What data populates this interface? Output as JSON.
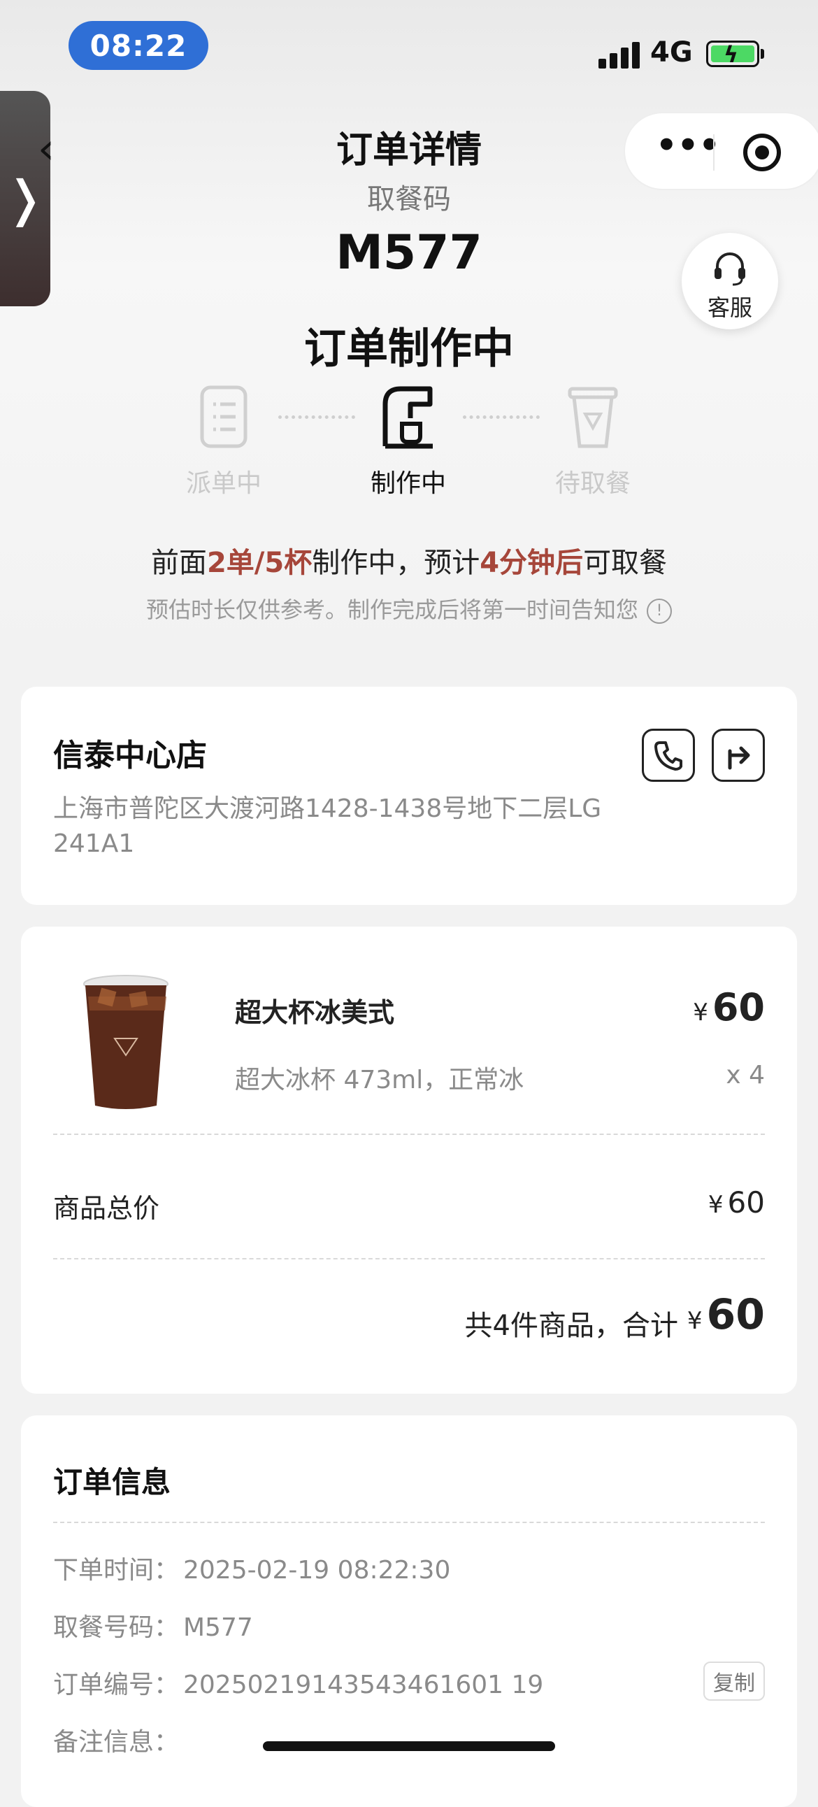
{
  "status_bar": {
    "time": "08:22",
    "network": "4G"
  },
  "nav": {
    "back_glyph": "‹",
    "title": "订单详情",
    "more_glyph": "•••",
    "side_tab_glyph": "❭"
  },
  "order_status": {
    "pickup_label": "取餐码",
    "pickup_code": "M577",
    "status_title": "订单制作中",
    "service_label": "客服",
    "steps": [
      {
        "label": "派单中",
        "state": "done"
      },
      {
        "label": "制作中",
        "state": "active"
      },
      {
        "label": "待取餐",
        "state": "pending"
      }
    ],
    "wait": {
      "prefix": "前面",
      "queue": "2单/5杯",
      "mid": "制作中，预计",
      "eta": "4分钟后",
      "suffix": "可取餐"
    },
    "note": "预估时长仅供参考。制作完成后将第一时间告知您",
    "note_icon": "!"
  },
  "store": {
    "name": "信泰中心店",
    "address": "上海市普陀区大渡河路1428-1438号地下二层LG 241A1"
  },
  "items": {
    "list": [
      {
        "name": "超大杯冰美式",
        "spec": "超大冰杯 473ml，正常冰",
        "currency": "¥",
        "price": "60",
        "qty": "x 4"
      }
    ],
    "subtotal_label": "商品总价",
    "subtotal_currency": "¥",
    "subtotal": "60",
    "total_text": "共4件商品，合计",
    "total_currency": "¥",
    "total": "60"
  },
  "order_info": {
    "title": "订单信息",
    "rows": [
      {
        "label": "下单时间：",
        "value": "2025-02-19 08:22:30"
      },
      {
        "label": "取餐号码：",
        "value": "M577"
      },
      {
        "label": "订单编号：",
        "value": "20250219143543461601 19"
      },
      {
        "label": "备注信息：",
        "value": ""
      }
    ],
    "copy_label": "复制"
  },
  "colors": {
    "accent": "#a6463a",
    "time_pill": "#2f6fd6",
    "battery": "#4cd964"
  }
}
